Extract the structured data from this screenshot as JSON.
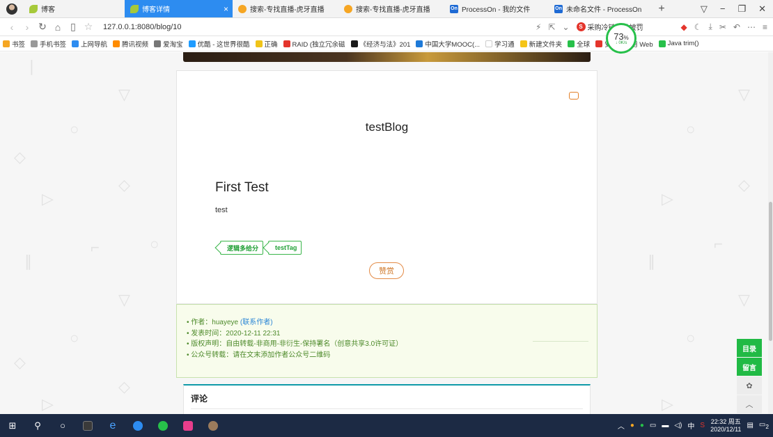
{
  "browser": {
    "tabs": [
      {
        "label": "博客",
        "icon": "leaf-icon"
      },
      {
        "label": "博客详情",
        "icon": "leaf-icon",
        "active": true
      },
      {
        "label": "搜索-专找直播-虎牙直播",
        "icon": "huya-icon"
      },
      {
        "label": "搜索-专找直播-虎牙直播",
        "icon": "huya-icon"
      },
      {
        "label": "ProcessOn - 我的文件",
        "icon": "processon-icon"
      },
      {
        "label": "未命名文件 - ProcessOn",
        "icon": "processon-icon"
      }
    ],
    "new_tab": "+",
    "url": "127.0.0.1:8080/blog/10",
    "search_text": "采购冷链食品被罚",
    "speed_percent": "73",
    "speed_unit": "%",
    "speed_rate": "↓ 0K/s"
  },
  "bookmarks": [
    {
      "label": "书签",
      "color": "#f5a623"
    },
    {
      "label": "手机书签",
      "color": "#999999"
    },
    {
      "label": "上网导航",
      "color": "#2d8cf0"
    },
    {
      "label": "腾讯视频",
      "color": "#ff8c00"
    },
    {
      "label": "爱淘宝",
      "color": "#777777"
    },
    {
      "label": "优酷 - 这世界很酷",
      "color": "#1f9cff"
    },
    {
      "label": "正确",
      "color": "#f0c419"
    },
    {
      "label": "RAID (独立冗余磁",
      "color": "#e4352c"
    },
    {
      "label": "《经济与法》201",
      "color": "#1a1a1a"
    },
    {
      "label": "中国大学MOOC(...",
      "color": "#1e7ad8"
    },
    {
      "label": "学习通",
      "color": "#ffffff"
    },
    {
      "label": "新建文件夹",
      "color": "#f5c518"
    },
    {
      "label": "全球",
      "color": "#27c04a"
    },
    {
      "label": "安卓上使用 Web",
      "color": "#e4352c"
    },
    {
      "label": "Java trim()",
      "color": "#27c04a"
    }
  ],
  "blog": {
    "name": "testBlog",
    "post_title": "First Test",
    "post_body": "test",
    "tags": [
      "逻辑多给分",
      "testTag"
    ],
    "reward_label": "赞赏"
  },
  "info": {
    "author_label": "作者：",
    "author": "huayeye",
    "contact": "(联系作者)",
    "publish_label": "发表时间：",
    "publish_time": "2020-12-11 22:31",
    "copyright": "版权声明：自由转载-非商用-非衍生-保持署名（创意共享3.0许可证）",
    "repost": "公众号转载：请在文末添加作者公众号二维码"
  },
  "comments": {
    "title": "评论"
  },
  "side_buttons": {
    "toc": "目录",
    "message": "留言",
    "wechat": "✿",
    "top": "︿"
  },
  "taskbar": {
    "ime": "中",
    "time": "22:32 周五",
    "date": "2020/12/11",
    "notifications": "2"
  },
  "colors": {
    "accent": "#2d8cf0",
    "tag_green": "#21a036",
    "info_bg": "#f8fcec",
    "teal": "#0f9aa8"
  }
}
